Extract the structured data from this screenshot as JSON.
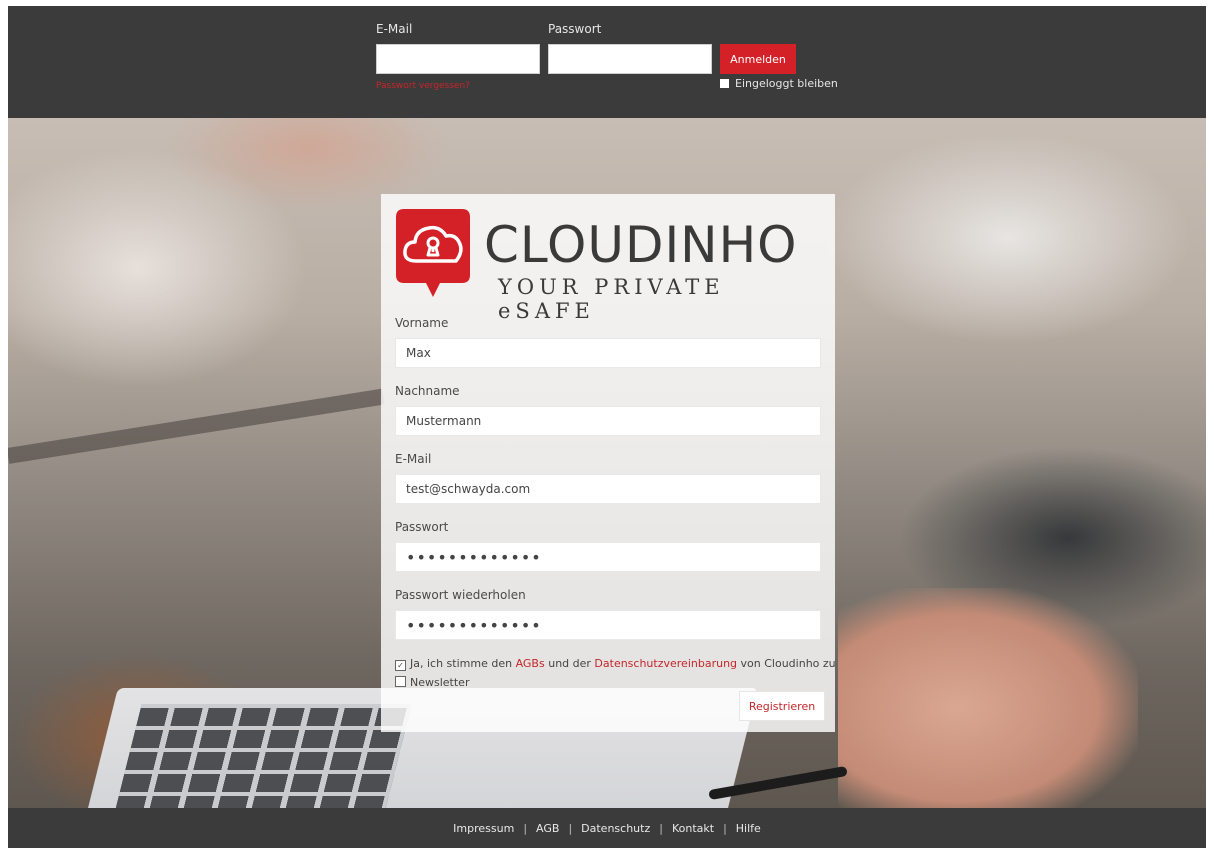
{
  "login": {
    "email_label": "E-Mail",
    "password_label": "Passwort",
    "email_value": "",
    "password_value": "",
    "submit_label": "Anmelden",
    "forgot_label": "Passwort vergessen?",
    "remember_label": "Eingeloggt bleiben",
    "accent_color": "#d42127"
  },
  "brand": {
    "name": "CLOUDINHO",
    "tagline": "YOUR PRIVATE eSAFE",
    "logo_icon": "cloud-lock-icon",
    "logo_color": "#d42127"
  },
  "form": {
    "firstname_label": "Vorname",
    "firstname_value": "Max",
    "lastname_label": "Nachname",
    "lastname_value": "Mustermann",
    "email_label": "E-Mail",
    "email_value": "test@schwayda.com",
    "password_label": "Passwort",
    "password_value": "•••••••••••••",
    "password_repeat_label": "Passwort wiederholen",
    "password_repeat_value": "•••••••••••••",
    "terms_prefix": "Ja, ich stimme den",
    "terms_agb_link": "AGBs",
    "terms_middle": "und der",
    "terms_privacy_link": "Datenschutzvereinbarung",
    "terms_suffix": "von Cloudinho zu",
    "terms_checked": true,
    "newsletter_label": "Newsletter",
    "newsletter_checked": false,
    "submit_label": "Registrieren"
  },
  "footer": {
    "links": [
      "Impressum",
      "AGB",
      "Datenschutz",
      "Kontakt",
      "Hilfe"
    ],
    "separator": "|"
  }
}
